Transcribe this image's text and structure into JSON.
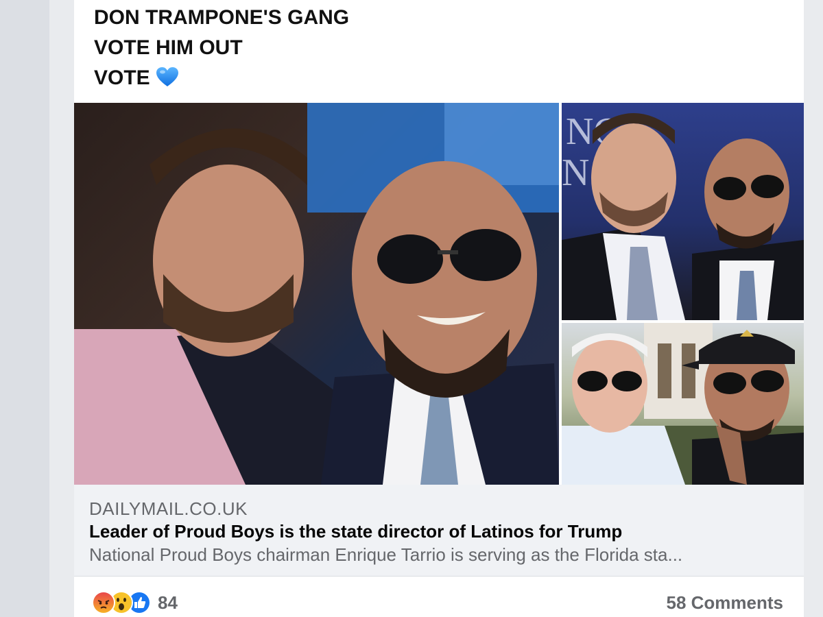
{
  "post": {
    "lines": [
      "DON TRAMPONE'S GANG",
      "VOTE HIM OUT",
      "VOTE"
    ],
    "heart_icon": "blue-heart-icon"
  },
  "link_preview": {
    "domain": "DAILYMAIL.CO.UK",
    "title": "Leader of Proud Boys is the state director of Latinos for Trump",
    "description": "National Proud Boys chairman Enrique Tarrio is serving as the Florida sta..."
  },
  "footer": {
    "reaction_icons": [
      "angry-reaction-icon",
      "wow-reaction-icon",
      "like-reaction-icon"
    ],
    "reaction_count": "84",
    "comments": "58 Comments"
  },
  "colors": {
    "card_bg": "#ffffff",
    "link_bg": "#f0f2f5",
    "muted_text": "#65676b",
    "like_blue": "#1877f2",
    "heart_blue": "#1e8ff2"
  }
}
